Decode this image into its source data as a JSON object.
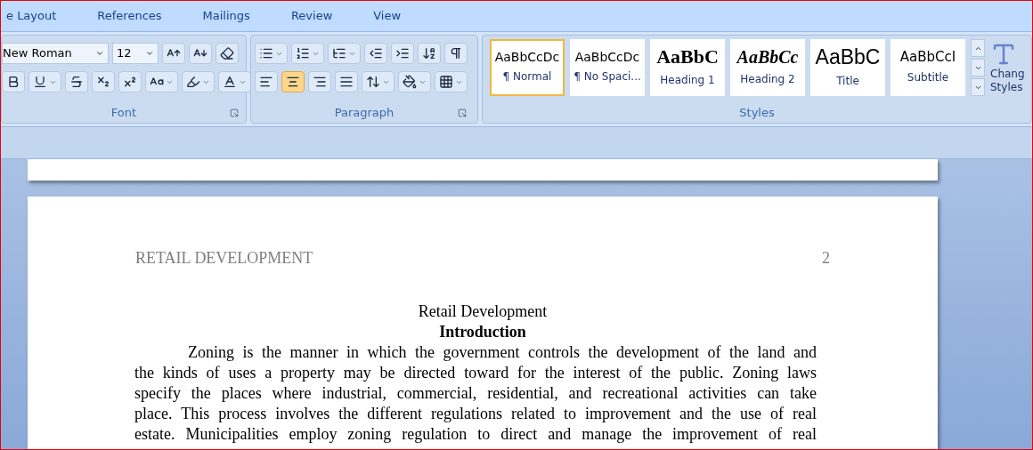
{
  "tabs": [
    {
      "label": "e Layout",
      "selected": false
    },
    {
      "label": "References",
      "selected": false
    },
    {
      "label": "Mailings",
      "selected": false
    },
    {
      "label": "Review",
      "selected": false
    },
    {
      "label": "View",
      "selected": false
    }
  ],
  "font": {
    "name": "New Roman",
    "size": "12",
    "group_label": "Font"
  },
  "paragraph": {
    "group_label": "Paragraph",
    "alignment": [
      {
        "kind": "left",
        "selected": false
      },
      {
        "kind": "center",
        "selected": true
      },
      {
        "kind": "right",
        "selected": false
      },
      {
        "kind": "justify",
        "selected": false
      }
    ]
  },
  "styles": {
    "group_label": "Styles",
    "items": [
      {
        "preview": "AaBbCcDc",
        "label": "¶ Normal",
        "kind": "normal",
        "selected": true
      },
      {
        "preview": "AaBbCcDc",
        "label": "¶ No Spaci...",
        "kind": "normal",
        "selected": false
      },
      {
        "preview": "AaBbC",
        "label": "Heading 1",
        "kind": "heading1",
        "selected": false
      },
      {
        "preview": "AaBbCc",
        "label": "Heading 2",
        "kind": "heading2",
        "selected": false
      },
      {
        "preview": "AaBbC",
        "label": "Title",
        "kind": "title",
        "selected": false
      },
      {
        "preview": "AaBbCcI",
        "label": "Subtitle",
        "kind": "subtitle",
        "selected": false
      }
    ],
    "change_styles": "Chang Styles"
  },
  "document": {
    "header": "RETAIL DEVELOPMENT",
    "page_number": "2",
    "title": "Retail Development",
    "heading": "Introduction",
    "paragraph_lines": [
      "Zoning is the manner in which the government controls the development of the land and",
      "the kinds of uses a property may be directed toward for the interest of the public. Zoning laws",
      "specify the places where industrial, commercial, residential, and recreational activities can take",
      "place. This process involves the different regulations related to improvement and the use of real",
      "estate. Municipalities employ zoning regulation to direct and manage the improvement of real"
    ]
  }
}
